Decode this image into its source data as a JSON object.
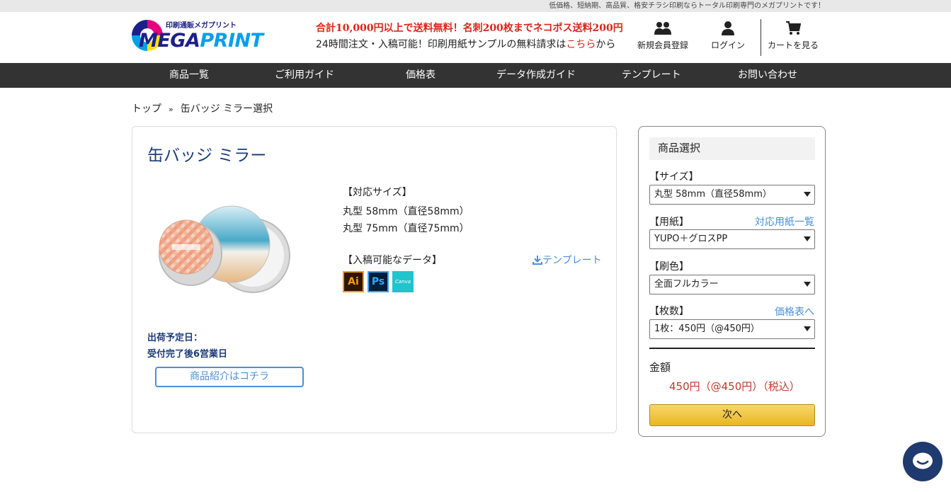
{
  "topbar": {
    "text": "低価格、短納期、高品質、格安チラシ印刷ならトータル印刷専門のメガプリントです！"
  },
  "header": {
    "logo_sub": "印刷通販メガプリント",
    "logo_word_1": "MEGA",
    "logo_word_2": "PRINT",
    "promo": "合計10,000円以上で送料無料！名刺200枚までネコポス送料200円",
    "notice_prefix": "24時間注文・入稿可能！印刷用紙サンプルの無料請求は",
    "notice_link": "こちら",
    "notice_suffix": "から",
    "register_label": "新規会員登録",
    "login_label": "ログイン",
    "cart_label": "カートを見る"
  },
  "nav": [
    {
      "label": "商品一覧"
    },
    {
      "label": "ご利用ガイド"
    },
    {
      "label": "価格表"
    },
    {
      "label": "データ作成ガイド"
    },
    {
      "label": "テンプレート"
    },
    {
      "label": "お問い合わせ"
    }
  ],
  "breadcrumb": {
    "home": "トップ",
    "sep": "»",
    "current": "缶バッジ ミラー選択"
  },
  "product": {
    "title": "缶バッジ ミラー",
    "size_heading": "【対応サイズ】",
    "sizes": [
      "丸型 58mm（直径58mm）",
      "丸型 75mm（直径75mm）"
    ],
    "data_heading": "【入稿可能なデータ】",
    "template_link": "テンプレート",
    "formats": [
      {
        "label": "Ai",
        "icon": "illustrator-icon"
      },
      {
        "label": "Ps",
        "icon": "photoshop-icon"
      },
      {
        "label": "Canva",
        "icon": "canva-icon"
      }
    ],
    "ship_label": "出荷予定日：",
    "ship_value": "受付完了後6営業日",
    "intro_button": "商品紹介はコチラ"
  },
  "sidebar": {
    "title": "商品選択",
    "size_label": "【サイズ】",
    "size_value": "丸型 58mm（直径58mm）",
    "paper_label": "【用紙】",
    "paper_link": "対応用紙一覧",
    "paper_value": "YUPO＋グロスPP",
    "color_label": "【刷色】",
    "color_value": "全面フルカラー",
    "qty_label": "【枚数】",
    "qty_link": "価格表へ",
    "qty_value": "1枚：450円（@450円）",
    "amount_label": "金額",
    "amount_value": "450円（@450円）（税込）",
    "next_button": "次へ"
  },
  "colors": {
    "accent": "#4a90d6",
    "promo": "#d9261c",
    "nav_bg": "#333333",
    "button": "#e8b623",
    "chat": "#1f3a6e"
  }
}
